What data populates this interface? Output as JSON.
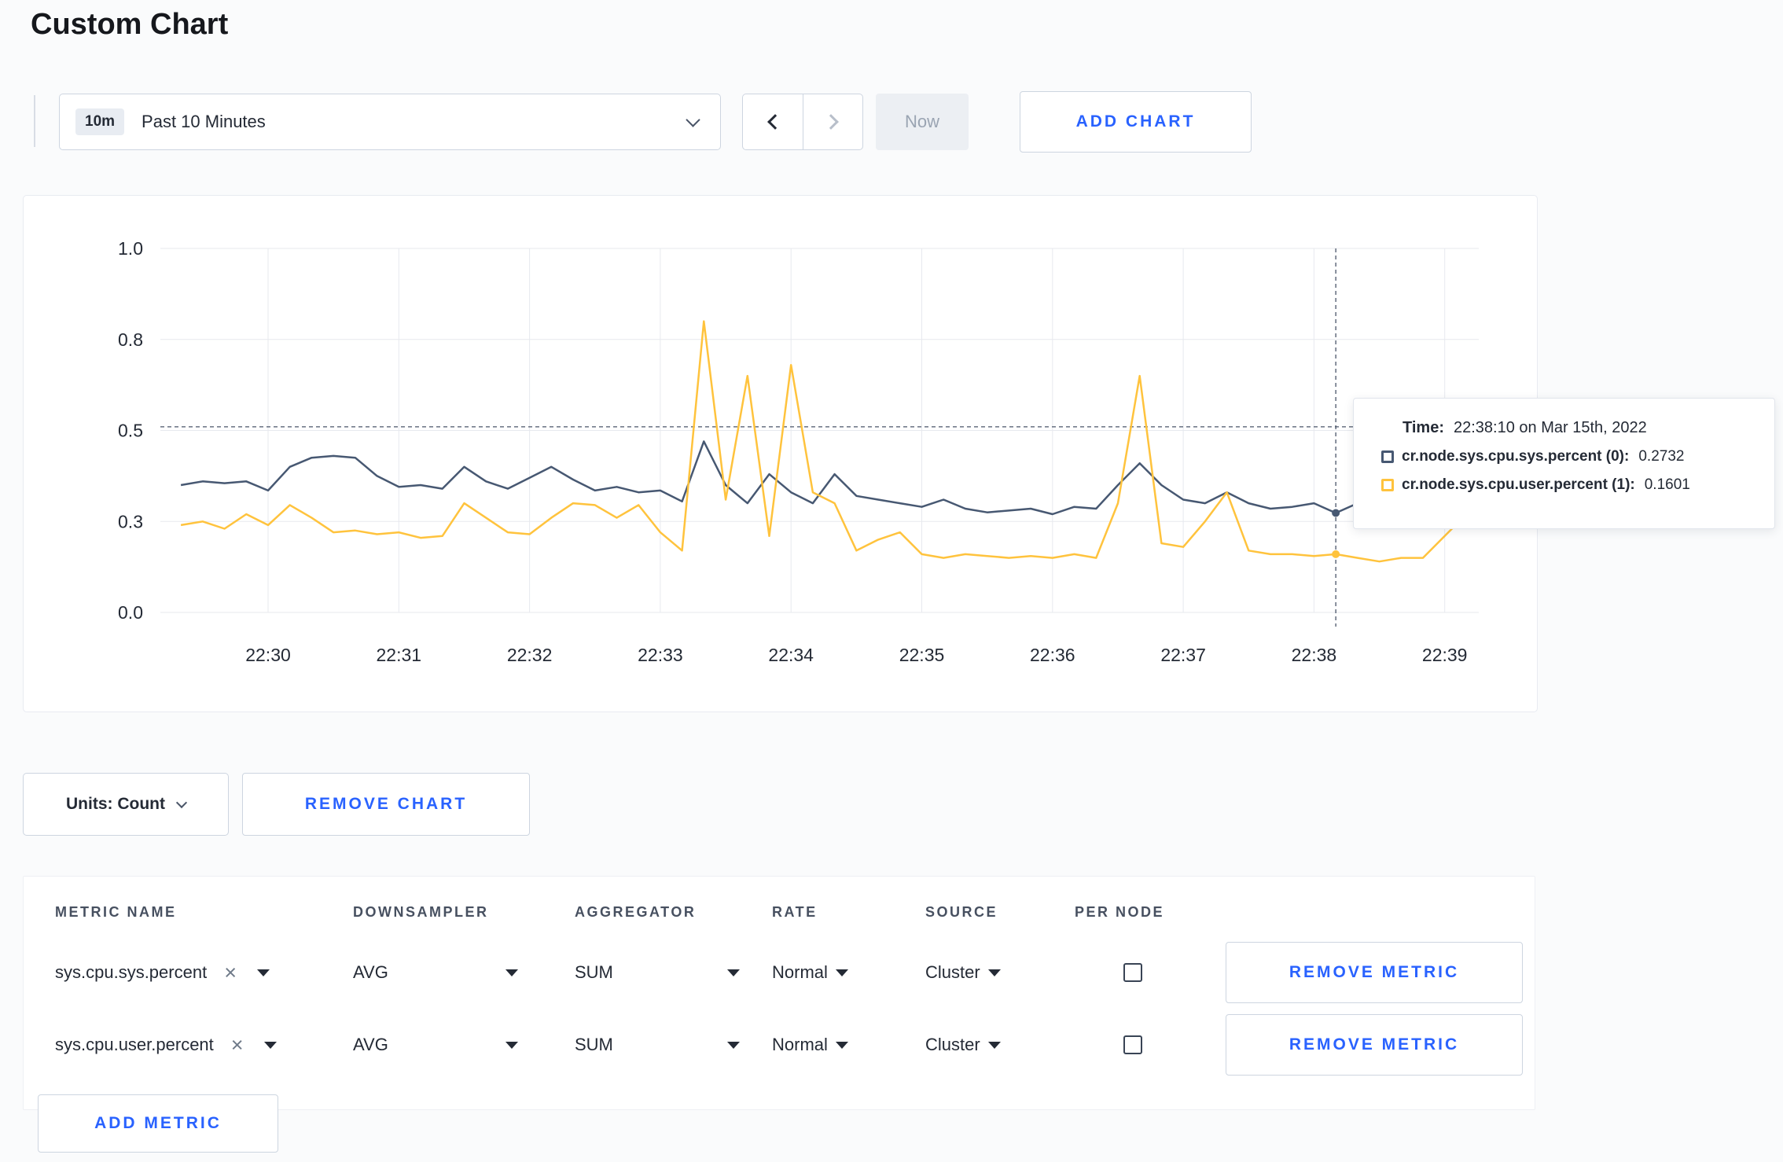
{
  "accent_color": "#2962ff",
  "page": {
    "title": "Custom Chart"
  },
  "toolbar": {
    "time_range_badge": "10m",
    "time_range_label": "Past 10 Minutes",
    "now_label": "Now",
    "add_chart_label": "ADD CHART"
  },
  "tooltip": {
    "time_label": "Time:",
    "time_value": "22:38:10 on Mar 15th, 2022",
    "series": [
      {
        "label": "cr.node.sys.cpu.sys.percent (0):",
        "value": "0.2732"
      },
      {
        "label": "cr.node.sys.cpu.user.percent (1):",
        "value": "0.1601"
      }
    ]
  },
  "chart_actions": {
    "units_label": "Units: Count",
    "remove_chart_label": "REMOVE CHART"
  },
  "metrics_table": {
    "headers": [
      "METRIC NAME",
      "DOWNSAMPLER",
      "AGGREGATOR",
      "RATE",
      "SOURCE",
      "PER NODE"
    ],
    "rows": [
      {
        "metric": "sys.cpu.sys.percent",
        "downsampler": "AVG",
        "aggregator": "SUM",
        "rate": "Normal",
        "source": "Cluster",
        "per_node": false,
        "remove_label": "REMOVE METRIC"
      },
      {
        "metric": "sys.cpu.user.percent",
        "downsampler": "AVG",
        "aggregator": "SUM",
        "rate": "Normal",
        "source": "Cluster",
        "per_node": false,
        "remove_label": "REMOVE METRIC"
      }
    ],
    "add_metric_label": "ADD METRIC"
  },
  "chart_data": {
    "type": "line",
    "title": "",
    "xlabel": "",
    "ylabel": "",
    "ylim": [
      0,
      1
    ],
    "grid": true,
    "legend_position": "tooltip",
    "y_ticks": [
      {
        "v": 0,
        "label": "0.0"
      },
      {
        "v": 0.25,
        "label": "0.3"
      },
      {
        "v": 0.5,
        "label": "0.5"
      },
      {
        "v": 0.75,
        "label": "0.8"
      },
      {
        "v": 1,
        "label": "1.0"
      }
    ],
    "x_tick_labels": [
      "22:30",
      "22:31",
      "22:32",
      "22:33",
      "22:34",
      "22:35",
      "22:36",
      "22:37",
      "22:38",
      "22:39"
    ],
    "start_offset_minutes": -0.6667,
    "interval_minutes": 0.16667,
    "series": [
      {
        "name": "cr.node.sys.cpu.sys.percent",
        "color": "#475872",
        "values": [
          0.35,
          0.36,
          0.355,
          0.36,
          0.335,
          0.4,
          0.425,
          0.43,
          0.425,
          0.375,
          0.345,
          0.35,
          0.34,
          0.4,
          0.36,
          0.34,
          0.37,
          0.4,
          0.365,
          0.335,
          0.345,
          0.33,
          0.335,
          0.305,
          0.47,
          0.35,
          0.3,
          0.38,
          0.33,
          0.3,
          0.38,
          0.32,
          0.31,
          0.3,
          0.29,
          0.31,
          0.285,
          0.275,
          0.28,
          0.285,
          0.27,
          0.29,
          0.285,
          0.35,
          0.41,
          0.35,
          0.31,
          0.3,
          0.33,
          0.3,
          0.285,
          0.29,
          0.3,
          0.2732,
          0.3,
          0.32,
          0.305,
          0.295,
          0.305,
          0.3
        ]
      },
      {
        "name": "cr.node.sys.cpu.user.percent",
        "color": "#ffc33d",
        "values": [
          0.24,
          0.25,
          0.23,
          0.27,
          0.24,
          0.295,
          0.26,
          0.22,
          0.225,
          0.215,
          0.22,
          0.205,
          0.21,
          0.3,
          0.26,
          0.22,
          0.215,
          0.26,
          0.3,
          0.295,
          0.26,
          0.295,
          0.22,
          0.17,
          0.8,
          0.31,
          0.65,
          0.21,
          0.68,
          0.33,
          0.3,
          0.17,
          0.2,
          0.22,
          0.16,
          0.15,
          0.16,
          0.155,
          0.15,
          0.155,
          0.15,
          0.16,
          0.15,
          0.3,
          0.65,
          0.19,
          0.18,
          0.25,
          0.33,
          0.17,
          0.16,
          0.16,
          0.155,
          0.1601,
          0.15,
          0.14,
          0.15,
          0.15,
          0.21,
          0.27
        ]
      }
    ],
    "hover": {
      "index": 53,
      "time": "22:38:10 on Mar 15th, 2022",
      "crosshair_y_value": 0.51,
      "values": [
        0.2732,
        0.1601
      ]
    }
  }
}
